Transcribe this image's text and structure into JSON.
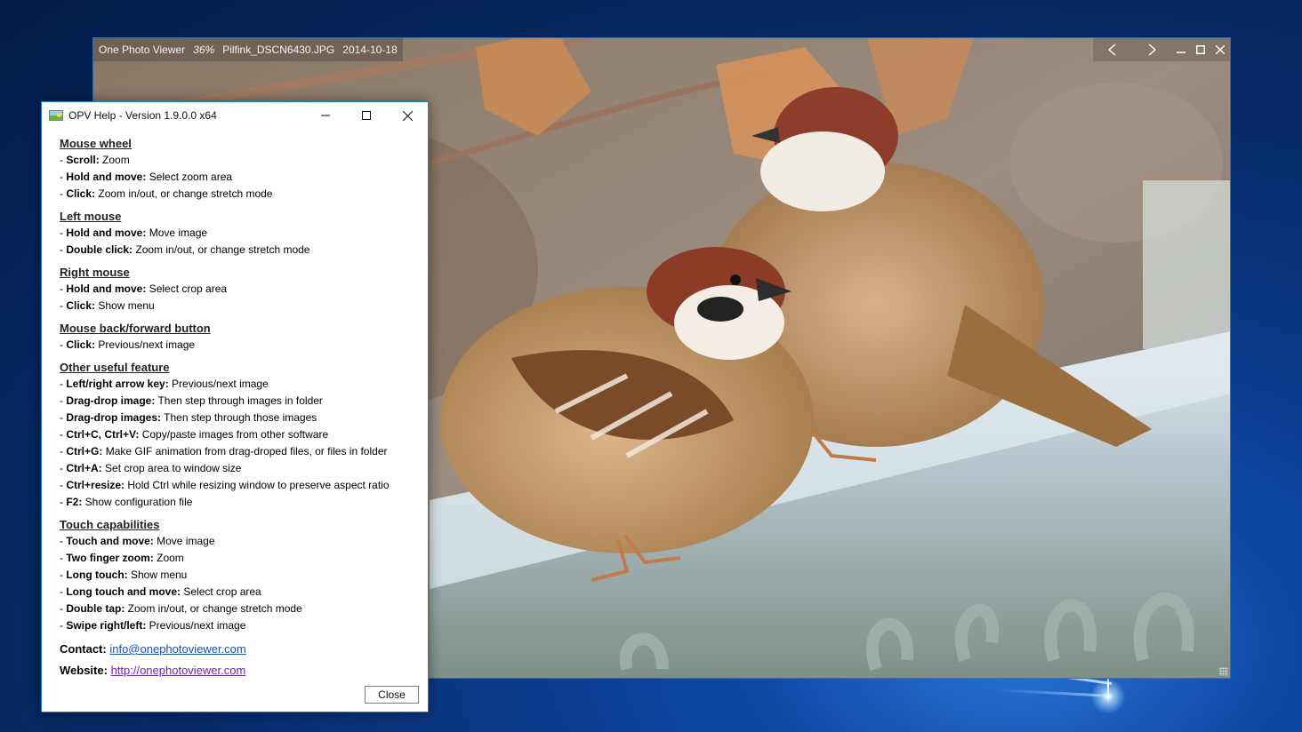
{
  "viewer": {
    "app_name": "One Photo Viewer",
    "zoom": "36%",
    "filename": "Pilfink_DSCN6430.JPG",
    "date": "2014-10-18",
    "prev_icon": "chevron-left-icon",
    "next_icon": "chevron-right-icon"
  },
  "help": {
    "title": "OPV Help - Version 1.9.0.0 x64",
    "sections": [
      {
        "heading": "Mouse wheel",
        "items": [
          {
            "key": "Scroll:",
            "text": " Zoom"
          },
          {
            "key": "Hold and move:",
            "text": " Select zoom area"
          },
          {
            "key": "Click:",
            "text": " Zoom in/out, or change stretch mode"
          }
        ]
      },
      {
        "heading": "Left mouse",
        "items": [
          {
            "key": "Hold and move:",
            "text": " Move image"
          },
          {
            "key": "Double click:",
            "text": " Zoom in/out, or change stretch mode"
          }
        ]
      },
      {
        "heading": "Right mouse",
        "items": [
          {
            "key": "Hold and move:",
            "text": " Select crop area"
          },
          {
            "key": "Click:",
            "text": " Show menu"
          }
        ]
      },
      {
        "heading": "Mouse back/forward button",
        "items": [
          {
            "key": "Click:",
            "text": " Previous/next image"
          }
        ]
      },
      {
        "heading": "Other useful feature",
        "items": [
          {
            "key": "Left/right arrow key:",
            "text": " Previous/next image"
          },
          {
            "key": "Drag-drop image:",
            "text": " Then step through images in folder"
          },
          {
            "key": "Drag-drop images:",
            "text": " Then step through those images"
          },
          {
            "key": "Ctrl+C, Ctrl+V:",
            "text": " Copy/paste images from other software"
          },
          {
            "key": "Ctrl+G:",
            "text": " Make GIF animation from drag-droped files, or files in folder"
          },
          {
            "key": "Ctrl+A:",
            "text": " Set crop area to window size"
          },
          {
            "key": "Ctrl+resize:",
            "text": " Hold Ctrl while resizing window to preserve aspect ratio"
          },
          {
            "key": "F2:",
            "text": " Show configuration file"
          }
        ]
      },
      {
        "heading": "Touch capabilities",
        "items": [
          {
            "key": "Touch and move:",
            "text": " Move image"
          },
          {
            "key": "Two finger zoom:",
            "text": " Zoom"
          },
          {
            "key": "Long touch:",
            "text": " Show menu"
          },
          {
            "key": "Long touch and move:",
            "text": " Select crop area"
          },
          {
            "key": "Double tap:",
            "text": " Zoom in/out, or change stretch mode"
          },
          {
            "key": "Swipe right/left:",
            "text": " Previous/next image"
          }
        ]
      }
    ],
    "contact_label": "Contact:",
    "contact_email": "info@onephotoviewer.com",
    "website_label": "Website:",
    "website_url": "http://onephotoviewer.com",
    "close_label": "Close"
  }
}
